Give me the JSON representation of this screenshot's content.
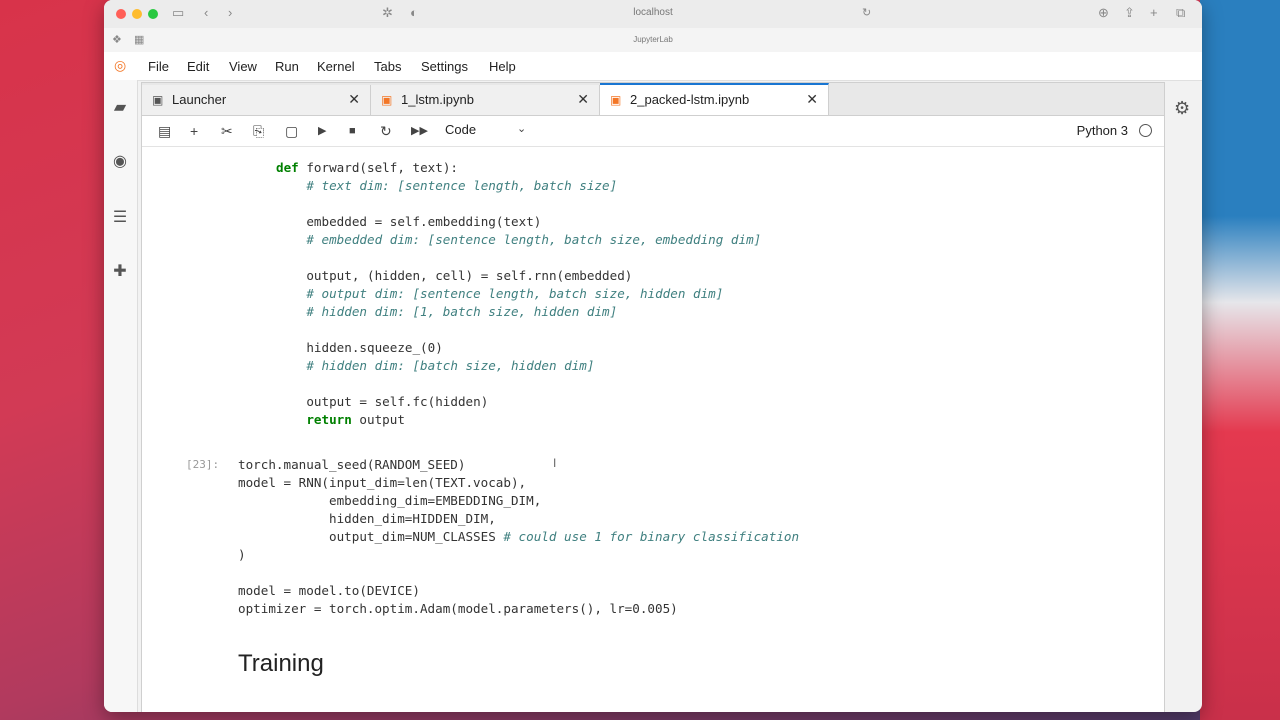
{
  "browser": {
    "url": "localhost",
    "page_title": "JupyterLab"
  },
  "menu": [
    "File",
    "Edit",
    "View",
    "Run",
    "Kernel",
    "Tabs",
    "Settings",
    "Help"
  ],
  "tabs": [
    {
      "label": "Launcher",
      "close": "✕"
    },
    {
      "label": "1_lstm.ipynb",
      "close": "✕"
    },
    {
      "label": "2_packed-lstm.ipynb",
      "close": "✕"
    }
  ],
  "toolbar": {
    "cell_type": "Code",
    "kernel_name": "Python 3"
  },
  "cells": {
    "class_code": [
      "def forward(self, text):",
      "    # text dim: [sentence length, batch size]",
      "",
      "    embedded = self.embedding(text)",
      "    # embedded dim: [sentence length, batch size, embedding dim]",
      "",
      "    output, (hidden, cell) = self.rnn(embedded)",
      "    # output dim: [sentence length, batch size, hidden dim]",
      "    # hidden dim: [1, batch size, hidden dim]",
      "",
      "    hidden.squeeze_(0)",
      "    # hidden dim: [batch size, hidden dim]",
      "",
      "    output = self.fc(hidden)",
      "    return output"
    ],
    "model_prompt": "[23]:",
    "model_code": [
      "torch.manual_seed(RANDOM_SEED)",
      "model = RNN(input_dim=len(TEXT.vocab),",
      "            embedding_dim=EMBEDDING_DIM,",
      "            hidden_dim=HIDDEN_DIM,",
      "            output_dim=NUM_CLASSES # could use 1 for binary classification",
      ")",
      "",
      "model = model.to(DEVICE)",
      "optimizer = torch.optim.Adam(model.parameters(), lr=0.005)"
    ],
    "heading": "Training"
  }
}
